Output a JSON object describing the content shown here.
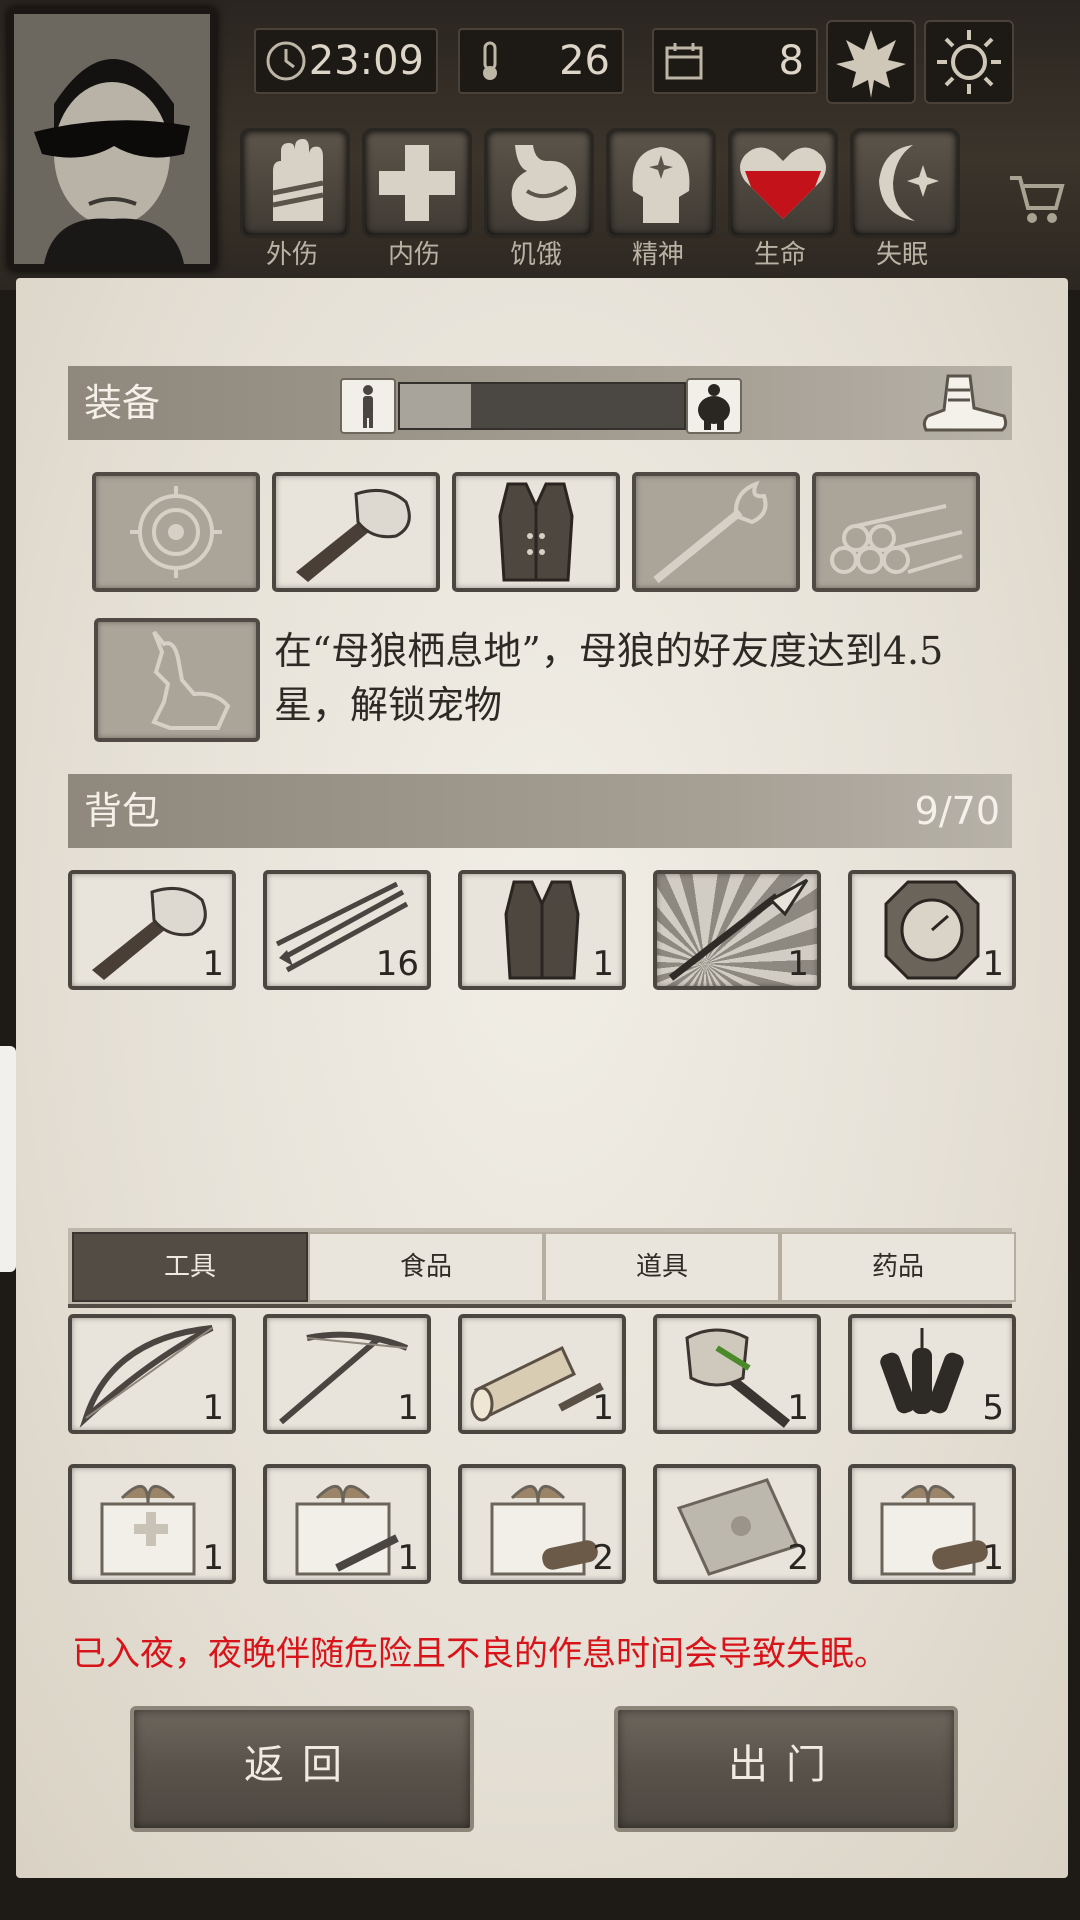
{
  "header": {
    "time": "23:09",
    "temperature": "26",
    "day": "8",
    "statuses": [
      {
        "label": "外伤",
        "icon": "bandaged-hand-icon"
      },
      {
        "label": "内伤",
        "icon": "cross-icon"
      },
      {
        "label": "饥饿",
        "icon": "stomach-icon"
      },
      {
        "label": "精神",
        "icon": "mind-icon"
      },
      {
        "label": "生命",
        "icon": "heart-icon"
      },
      {
        "label": "失眠",
        "icon": "moon-star-icon"
      }
    ]
  },
  "equipment": {
    "title": "装备",
    "weight_level": 0.25,
    "slots": [
      {
        "item": "target-icon",
        "empty": true
      },
      {
        "item": "stone-hammer-icon",
        "empty": false
      },
      {
        "item": "leather-vest-icon",
        "empty": false
      },
      {
        "item": "torch-icon",
        "empty": true
      },
      {
        "item": "log-bundle-icon",
        "empty": true
      }
    ],
    "pet_slot": "wolf-icon",
    "pet_hint": "在“母狼栖息地”，母狼的好友度达到4.5星，解锁宠物"
  },
  "backpack": {
    "title": "背包",
    "capacity": "9/70",
    "items": [
      {
        "item": "stone-hammer-icon",
        "count": "1"
      },
      {
        "item": "arrows-icon",
        "count": "16"
      },
      {
        "item": "leather-vest-icon",
        "count": "1"
      },
      {
        "item": "spear-icon",
        "count": "1"
      },
      {
        "item": "compass-icon",
        "count": "1"
      }
    ]
  },
  "tabs": [
    "工具",
    "食品",
    "道具",
    "药品"
  ],
  "storage": {
    "row1": [
      {
        "item": "bow-icon",
        "count": "1"
      },
      {
        "item": "crossbow-icon",
        "count": "1"
      },
      {
        "item": "flashlight-icon",
        "count": "1"
      },
      {
        "item": "stone-axe-icon",
        "count": "1"
      },
      {
        "item": "dynamite-icon",
        "count": "5"
      }
    ],
    "row2": [
      {
        "item": "medical-gift-box-icon",
        "count": "1"
      },
      {
        "item": "tool-gift-box-icon",
        "count": "1"
      },
      {
        "item": "wood-gift-box-icon",
        "count": "2"
      },
      {
        "item": "envelope-icon",
        "count": "2"
      },
      {
        "item": "wood-gift-box-icon",
        "count": "1"
      }
    ]
  },
  "warning": "已入夜，夜晚伴随危险且不良的作息时间会导致失眠。",
  "buttons": {
    "back": "返回",
    "go_out": "出门"
  }
}
